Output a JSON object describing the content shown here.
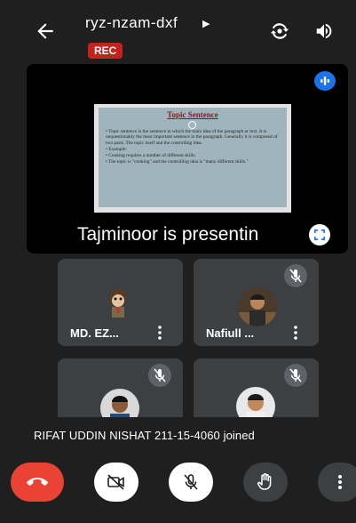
{
  "header": {
    "meeting_code": "ryz-nzam-dxf",
    "rec_badge": "REC",
    "icons": [
      "back-arrow-icon",
      "caret-right-icon",
      "flip-camera-icon",
      "speaker-icon"
    ]
  },
  "presentation": {
    "caption": "Tajminoor is presentin",
    "slide": {
      "title": "Topic Sentence",
      "bullets": [
        "• Topic sentence is the sentence in which the main idea of the paragraph or text. It is unquestionably the most important sentence in the paragraph. Generally it is composed of two parts. The topic itself and the controlling idea.",
        "• Example:",
        "• Cooking requires a number of different skills.",
        "• The topic is \"cooking\" and the controlling idea is \"many different skills.\""
      ]
    }
  },
  "participants": [
    {
      "name": "MD. EZ...",
      "muted": false
    },
    {
      "name": "Nafiull ...",
      "muted": true
    },
    {
      "name": "",
      "muted": true
    },
    {
      "name": "",
      "muted": true
    }
  ],
  "notification": "RIFAT UDDIN NISHAT 211-15-4060 joined",
  "controls": {
    "icons": [
      "end-call-icon",
      "camera-off-icon",
      "mic-off-icon",
      "raise-hand-icon",
      "more-options-icon"
    ],
    "colors": {
      "end": "#ea4335",
      "rec": "#c5221f",
      "accent": "#1a73e8"
    }
  }
}
